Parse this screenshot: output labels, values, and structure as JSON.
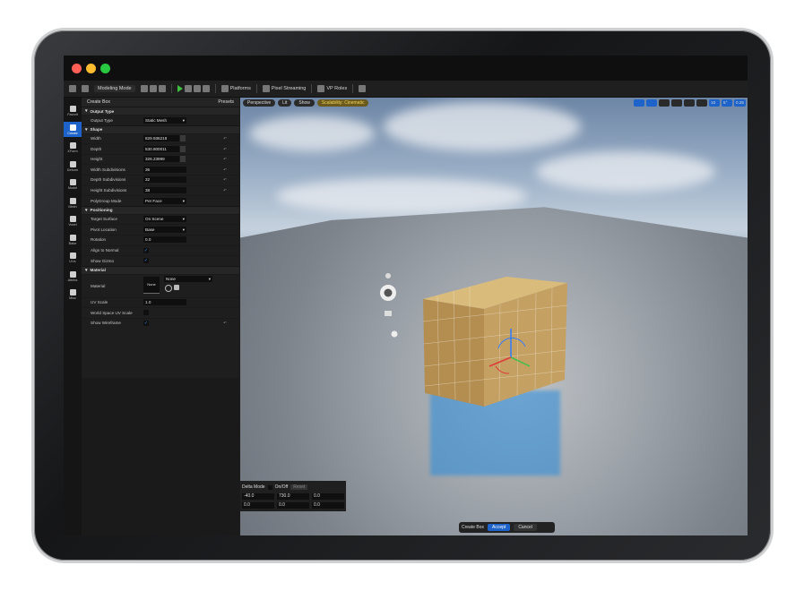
{
  "toolbar": {
    "mode": "Modeling Mode",
    "platforms": "Platforms",
    "pixel_streaming": "Pixel Streaming",
    "vp_roles": "VP Roles"
  },
  "rail": [
    {
      "label": "Favorit",
      "active": false
    },
    {
      "label": "Create",
      "active": true
    },
    {
      "label": "XForm",
      "active": false
    },
    {
      "label": "Deform",
      "active": false
    },
    {
      "label": "Model",
      "active": false
    },
    {
      "label": "Mesh",
      "active": false
    },
    {
      "label": "Voxel",
      "active": false
    },
    {
      "label": "Bake",
      "active": false
    },
    {
      "label": "UVs",
      "active": false
    },
    {
      "label": "Attribs",
      "active": false
    },
    {
      "label": "Misc",
      "active": false
    }
  ],
  "panel": {
    "title": "Create Box",
    "presets": "Presets",
    "sections": {
      "output_type": "Output Type",
      "shape": "Shape",
      "positioning": "Positioning",
      "material": "Material"
    },
    "output_type": {
      "label": "Output Type",
      "value": "Static Mesh"
    },
    "shape": [
      {
        "label": "Width",
        "value": "829.936218"
      },
      {
        "label": "Depth",
        "value": "530.800011"
      },
      {
        "label": "Height",
        "value": "326.23999"
      },
      {
        "label": "Width Subdivisions",
        "value": "36"
      },
      {
        "label": "Depth Subdivisions",
        "value": "32"
      },
      {
        "label": "Height Subdivisions",
        "value": "38"
      }
    ],
    "polygroup_mode": {
      "label": "PolyGroup Mode",
      "value": "Per Face"
    },
    "positioning": {
      "target_surface": {
        "label": "Target Surface",
        "value": "On Scene"
      },
      "pivot_location": {
        "label": "Pivot Location",
        "value": "Base"
      },
      "rotation": {
        "label": "Rotation",
        "value": "0.0"
      },
      "align_to_normal": {
        "label": "Align to Normal",
        "checked": true
      },
      "show_gizmo": {
        "label": "Show Gizmo",
        "checked": true
      }
    },
    "material": {
      "label": "Material",
      "thumb": "None",
      "value": "None",
      "uv_scale_label": "UV Scale",
      "uv_scale": "1.0",
      "world_uv_label": "World Space UV Scale",
      "wireframe_label": "Show Wireframe"
    }
  },
  "viewport": {
    "perspective": "Perspective",
    "lit": "Lit",
    "show": "Show",
    "scalability": "Scalability: Cinematic",
    "right_values": [
      "10",
      "5°",
      "0.25"
    ]
  },
  "delta": {
    "mode": "Delta Mode",
    "onoff": "On/Off",
    "reset": "Reset",
    "row1": [
      "-40.0",
      "730.0",
      "0.0"
    ],
    "row2": [
      "0.0",
      "0.0",
      "0.0"
    ]
  },
  "accept_bar": {
    "label": "Create Box",
    "accept": "Accept",
    "cancel": "Cancel"
  },
  "colors": {
    "accent": "#1d63c9",
    "scalability": "#f2d55b",
    "box": "#c9a96a"
  }
}
